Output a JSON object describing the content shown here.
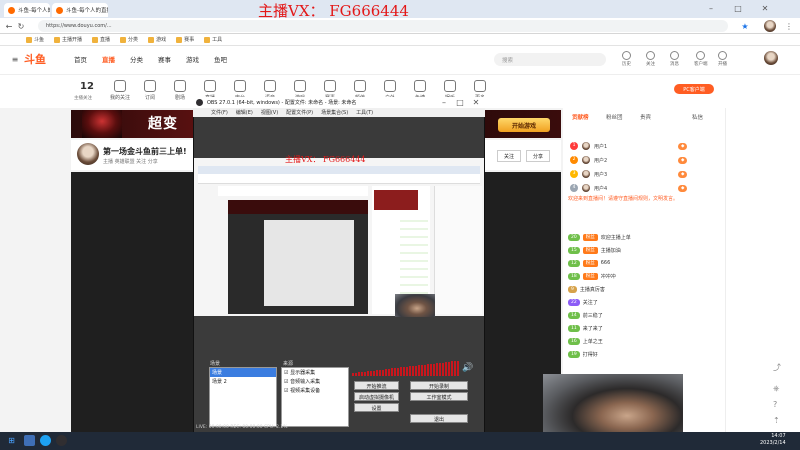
{
  "watermark": "主播VX： FG666444",
  "browser": {
    "tabs": [
      "斗鱼-每个人的直播平台",
      "斗鱼-每个人的直播平台 - Windows"
    ],
    "url": "https://www.douyu.com/...",
    "bookmarks": [
      "斗鱼",
      "主播开播",
      "直播",
      "分类",
      "游戏",
      "赛事",
      "工具"
    ]
  },
  "site": {
    "logo": "斗鱼",
    "nav": [
      "首页",
      "直播",
      "分类",
      "赛事",
      "游戏",
      "鱼吧"
    ],
    "nav_active": 1,
    "search_placeholder": "搜索",
    "header_icons": [
      "历史",
      "关注",
      "消息",
      "客户端",
      "开播"
    ],
    "follow_count": "12",
    "follow_label": "主播关注",
    "categories": [
      "我的关注",
      "订阅",
      "剧场",
      "直播",
      "电台",
      "语音",
      "游戏",
      "赛事",
      "颜值",
      "户外",
      "鱼塘",
      "娱乐",
      "更多"
    ],
    "pc_button": "PC客户端",
    "banner_text": "超变",
    "banner_button": "开始游戏",
    "room_title": "第一场金斗鱼前三上单!",
    "room_meta": "主播   英雄联盟   关注  分享",
    "follow_button": "关注",
    "share_button": "分享"
  },
  "obs": {
    "title": "OBS 27.0.1 (64-bit, windows) - 配置文件: 未命名 - 场景: 未命名",
    "menu": [
      "文件(F)",
      "编辑(E)",
      "视图(V)",
      "配置文件(P)",
      "场景集合(S)",
      "工具(T)",
      "帮助(H)"
    ],
    "watermark": "主播VX： FG666444",
    "scenes_label": "场景",
    "scenes": [
      "场景",
      "场景 2"
    ],
    "sources_label": "来源",
    "sources": [
      "显示器采集",
      "音频输入采集",
      "视频采集设备"
    ],
    "buttons": [
      "开始推流",
      "开始录制",
      "启动虚拟摄像机",
      "工作室模式",
      "设置",
      "退出"
    ],
    "status": "LIVE: 00:00:00   REC: 00:00:00   CPU: 2.1%"
  },
  "chat": {
    "tabs": [
      "贡献榜",
      "粉丝团",
      "贵宾",
      "私信"
    ],
    "active_tab": 0,
    "rank": [
      {
        "n": "1",
        "name": "用户1",
        "color": "#ff3b3b"
      },
      {
        "n": "2",
        "name": "用户2",
        "color": "#ff8a00"
      },
      {
        "n": "3",
        "name": "用户3",
        "color": "#ffb800"
      },
      {
        "n": "4",
        "name": "用户4",
        "color": "#9aa5b1"
      }
    ],
    "notice": "欢迎来到直播间！请遵守直播间规则，文明发言。",
    "messages": [
      {
        "lv": "20",
        "badge": "粉丝",
        "text": "欢迎主播上单",
        "lvc": "#6fbf4a"
      },
      {
        "lv": "15",
        "badge": "粉丝",
        "text": "主播加油",
        "lvc": "#6fbf4a"
      },
      {
        "lv": "12",
        "badge": "粉丝",
        "text": "666",
        "lvc": "#6fbf4a"
      },
      {
        "lv": "18",
        "badge": "粉丝",
        "text": "冲冲冲",
        "lvc": "#6fbf4a"
      },
      {
        "lv": "9",
        "badge": "",
        "text": "主播真厉害",
        "lvc": "#d6a24a"
      },
      {
        "lv": "22",
        "badge": "",
        "text": "关注了",
        "lvc": "#8b5cf6"
      },
      {
        "lv": "14",
        "badge": "",
        "text": "前三稳了",
        "lvc": "#6fbf4a"
      },
      {
        "lv": "11",
        "badge": "",
        "text": "来了来了",
        "lvc": "#6fbf4a"
      },
      {
        "lv": "16",
        "badge": "",
        "text": "上单之王",
        "lvc": "#6fbf4a"
      },
      {
        "lv": "19",
        "badge": "",
        "text": "打得好",
        "lvc": "#6fbf4a"
      }
    ]
  },
  "taskbar": {
    "time": "14:07",
    "date": "2023/2/14"
  },
  "colors": {
    "accent": "#ff5d23",
    "red": "#e31818"
  }
}
